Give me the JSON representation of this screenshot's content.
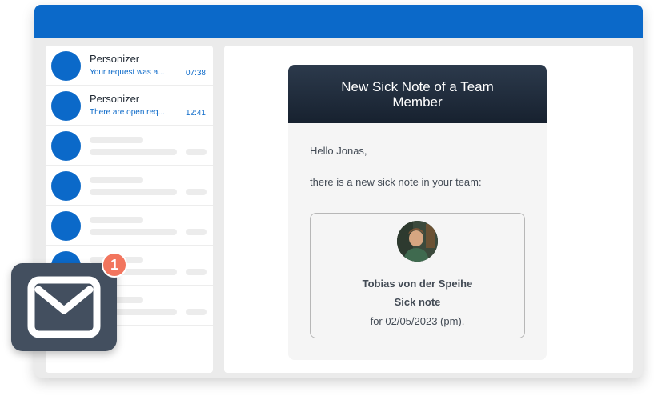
{
  "inbox": {
    "messages": [
      {
        "sender": "Personizer",
        "preview": "Your request was a...",
        "time": "07:38"
      },
      {
        "sender": "Personizer",
        "preview": "There are open req...",
        "time": "12:41"
      }
    ]
  },
  "email": {
    "title": "New Sick Note of a Team Member",
    "greeting": "Hello Jonas,",
    "intro": "there is a new sick note in your team:",
    "person_name": "Tobias von der Speihe",
    "note_type": "Sick note",
    "note_date": "for 02/05/2023 (pm)."
  },
  "notification": {
    "count": "1",
    "icon": "mail-icon"
  },
  "colors": {
    "brand_blue": "#0b69c9",
    "header_dark": "#1f2b3b",
    "badge": "#f2755e",
    "tile": "#434f5f"
  }
}
